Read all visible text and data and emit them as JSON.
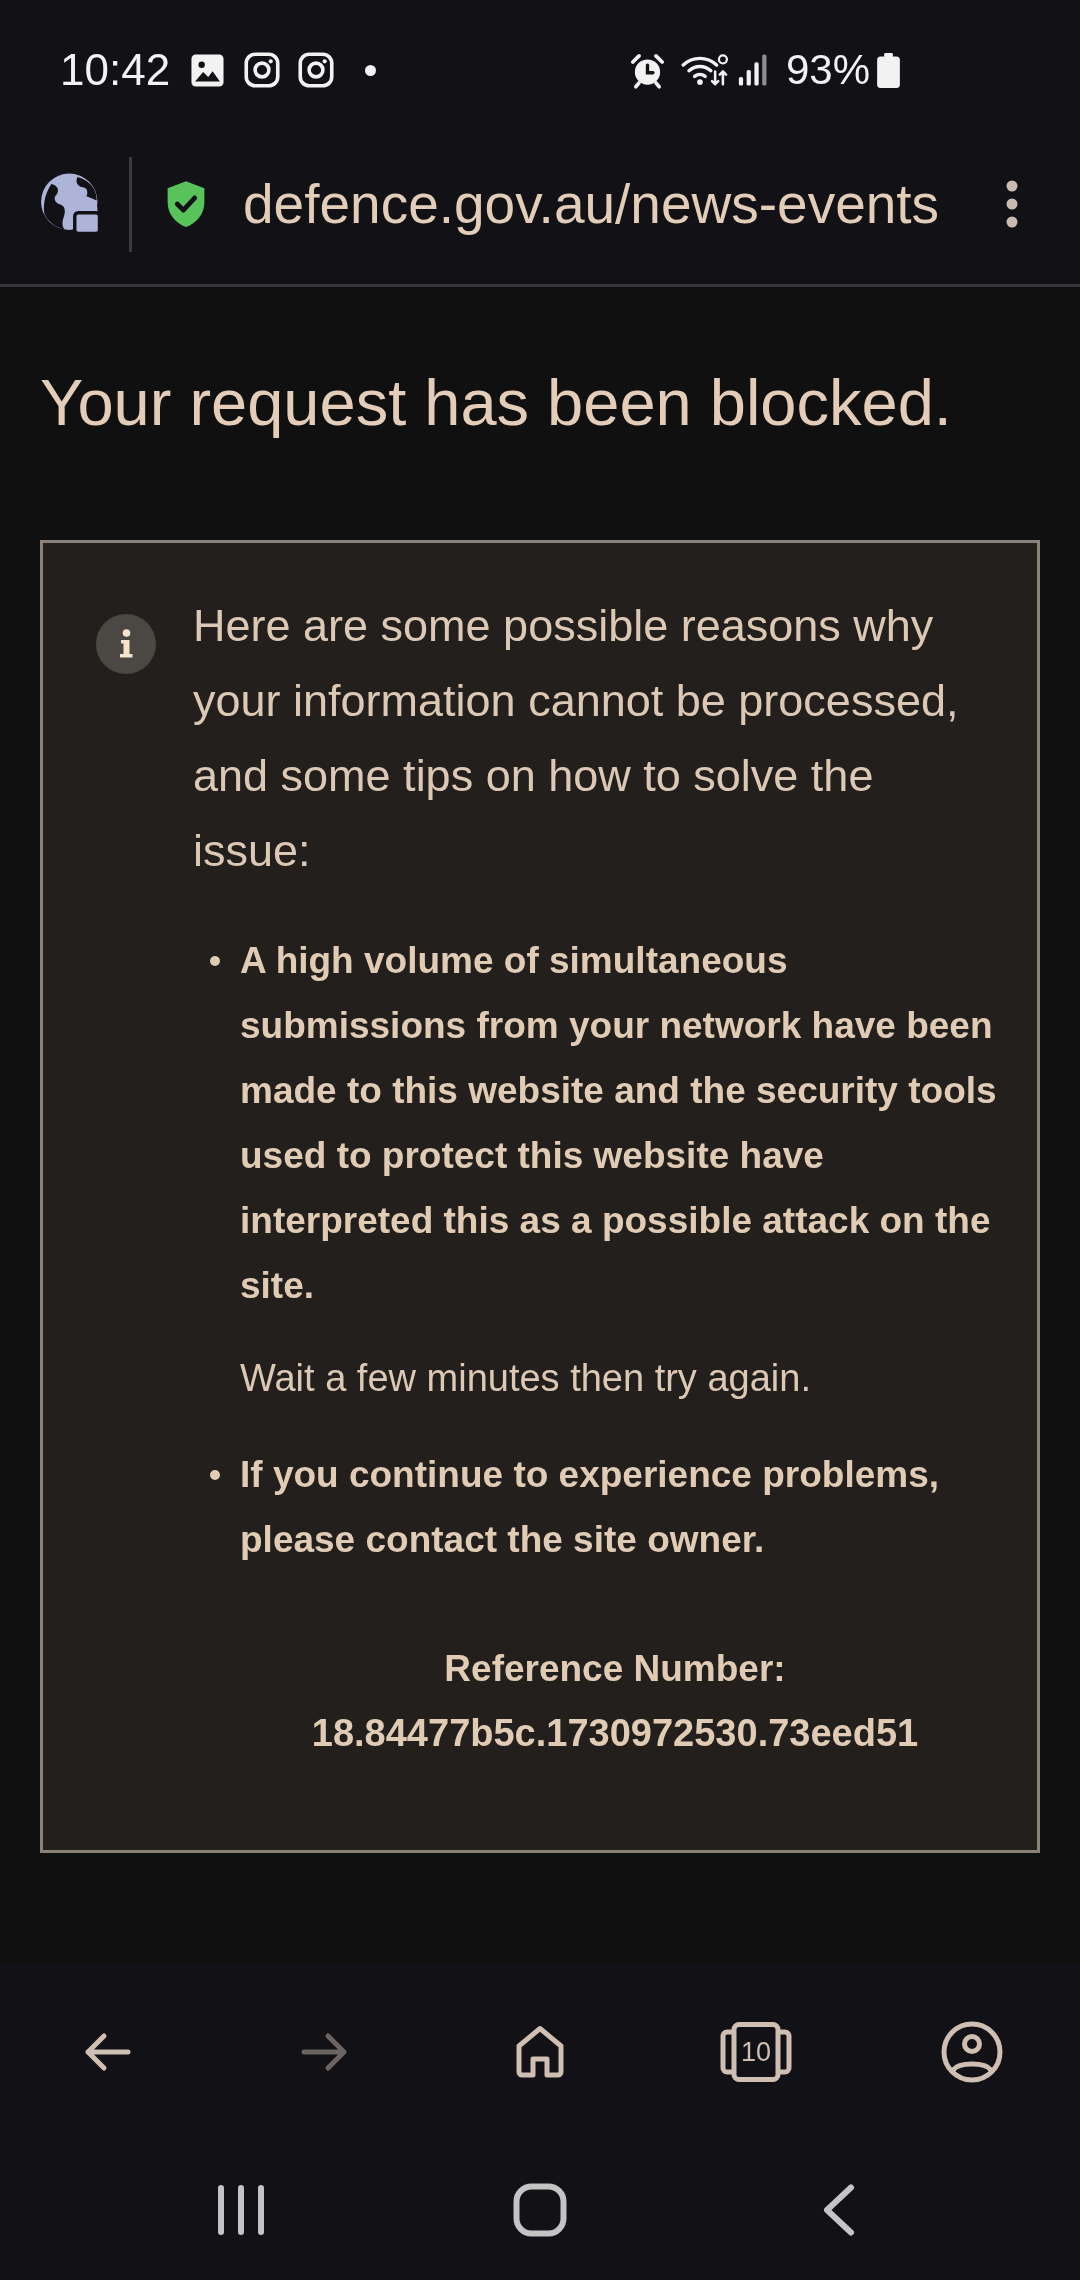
{
  "status_bar": {
    "time": "10:42",
    "battery": "93%"
  },
  "address_bar": {
    "url": "defence.gov.au/news-events"
  },
  "page": {
    "title": "Your request has been blocked.",
    "notice": {
      "intro": "Here are some possible reasons why your information cannot be processed, and some tips on how to solve the issue:",
      "items": [
        {
          "text": "A high volume of simultaneous submissions from your network have been made to this website and the security tools used to protect this website have interpreted this as a possible attack on the site.",
          "note": "Wait a few minutes then try again."
        },
        {
          "text": "If you continue to experience problems, please contact the site owner."
        }
      ],
      "reference_label": "Reference Number:",
      "reference_number": "18.84477b5c.1730972530.73eed51"
    }
  },
  "browser_toolbar": {
    "buttons": [
      {
        "kind": "back",
        "disabled": false
      },
      {
        "kind": "forward",
        "disabled": true
      },
      {
        "kind": "home",
        "disabled": false
      },
      {
        "kind": "tabs",
        "label": "10",
        "disabled": false
      },
      {
        "kind": "profile",
        "disabled": false
      }
    ]
  }
}
